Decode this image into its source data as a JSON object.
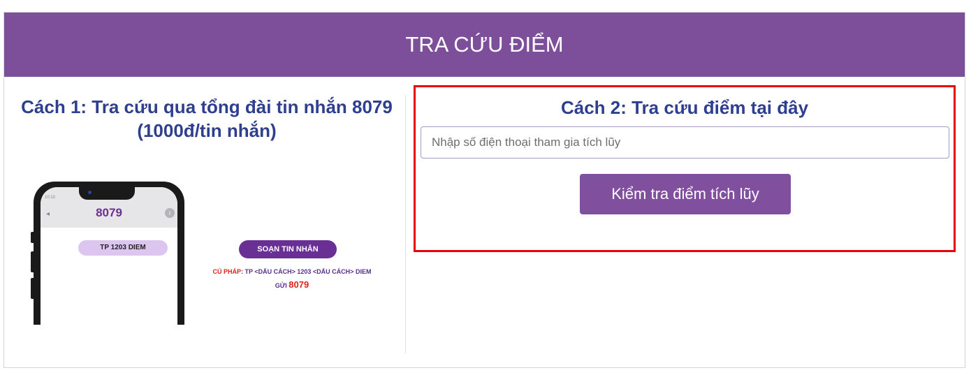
{
  "header": {
    "title": "TRA CỨU ĐIỂM"
  },
  "method1": {
    "title": "Cách 1: Tra cứu qua tổng đài tin nhắn 8079 (1000đ/tin nhắn)",
    "phone": {
      "time": "10:10",
      "number": "8079",
      "info_icon": "i",
      "message": "TP 1203 DIEM"
    },
    "compose_label": "SOẠN TIN NHẮN",
    "syntax_label": "CÚ PHÁP",
    "syntax_text": ": TP <DẤU CÁCH> 1203 <DẤU CÁCH> DIEM",
    "send_text": "GỬI",
    "send_number": "8079"
  },
  "method2": {
    "title": "Cách 2: Tra cứu điểm tại đây",
    "input_placeholder": "Nhập số điện thoại tham gia tích lũy",
    "input_value": "",
    "button_label": "Kiểm tra điểm tích lũy"
  },
  "colors": {
    "header_bg": "#7d4f9b",
    "title_blue": "#2e3f8f",
    "button_bg": "#804f9e",
    "highlight_border": "#e8000b",
    "accent_red": "#e0201d",
    "accent_purple": "#6a2f94"
  }
}
